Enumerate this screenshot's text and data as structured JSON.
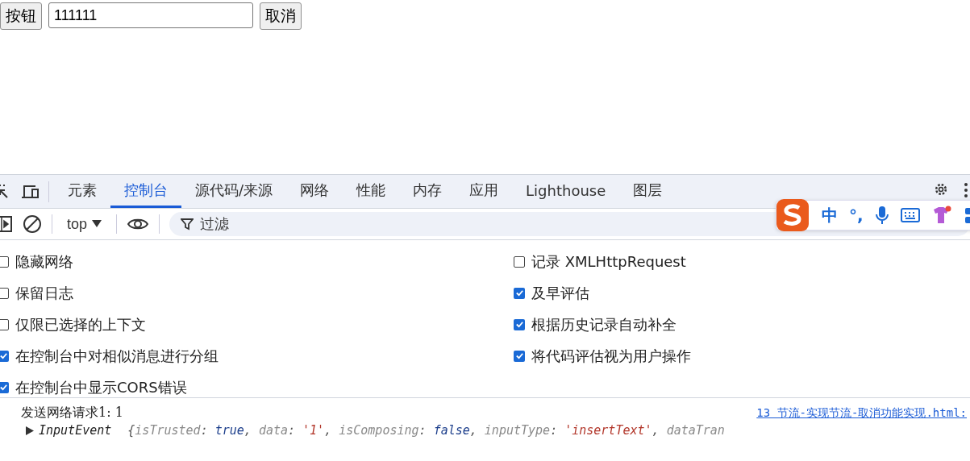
{
  "page": {
    "button": "按钮",
    "input_value": "111111",
    "cancel_button": "取消"
  },
  "devtools": {
    "tabs": [
      {
        "label": "元素",
        "selected": false
      },
      {
        "label": "控制台",
        "selected": true
      },
      {
        "label": "源代码/来源",
        "selected": false
      },
      {
        "label": "网络",
        "selected": false
      },
      {
        "label": "性能",
        "selected": false
      },
      {
        "label": "内存",
        "selected": false
      },
      {
        "label": "应用",
        "selected": false
      },
      {
        "label": "Lighthouse",
        "selected": false
      },
      {
        "label": "图层",
        "selected": false
      }
    ],
    "toolbar": {
      "context": "top",
      "filter_placeholder": "过滤"
    },
    "settings_left": [
      {
        "label": "隐藏网络",
        "checked": false
      },
      {
        "label": "保留日志",
        "checked": false
      },
      {
        "label": "仅限已选择的上下文",
        "checked": false
      },
      {
        "label": "在控制台中对相似消息进行分组",
        "checked": true
      },
      {
        "label": "在控制台中显示CORS错误",
        "checked": true
      }
    ],
    "settings_right": [
      {
        "label": "记录 XMLHttpRequest",
        "checked": false
      },
      {
        "label": "及早评估",
        "checked": true
      },
      {
        "label": "根据历史记录自动补全",
        "checked": true
      },
      {
        "label": "将代码评估视为用户操作",
        "checked": true
      }
    ],
    "console": {
      "message": "发送网络请求1: 1",
      "source": "13 节流-实现节流-取消功能实现.html:",
      "object_name": "InputEvent",
      "tokens": [
        {
          "text": "{",
          "kind": "punct"
        },
        {
          "text": "isTrusted",
          "kind": "key"
        },
        {
          "text": ": ",
          "kind": "punct"
        },
        {
          "text": "true",
          "kind": "literal"
        },
        {
          "text": ", ",
          "kind": "punct"
        },
        {
          "text": "data",
          "kind": "key"
        },
        {
          "text": ": ",
          "kind": "punct"
        },
        {
          "text": "'1'",
          "kind": "string"
        },
        {
          "text": ", ",
          "kind": "punct"
        },
        {
          "text": "isComposing",
          "kind": "key"
        },
        {
          "text": ": ",
          "kind": "punct"
        },
        {
          "text": "false",
          "kind": "literal"
        },
        {
          "text": ", ",
          "kind": "punct"
        },
        {
          "text": "inputType",
          "kind": "key"
        },
        {
          "text": ": ",
          "kind": "punct"
        },
        {
          "text": "'insertText'",
          "kind": "string"
        },
        {
          "text": ", ",
          "kind": "punct"
        },
        {
          "text": "dataTran",
          "kind": "key"
        }
      ]
    }
  },
  "ime_bar": {
    "mode": "中",
    "punctuation": "°,"
  }
}
